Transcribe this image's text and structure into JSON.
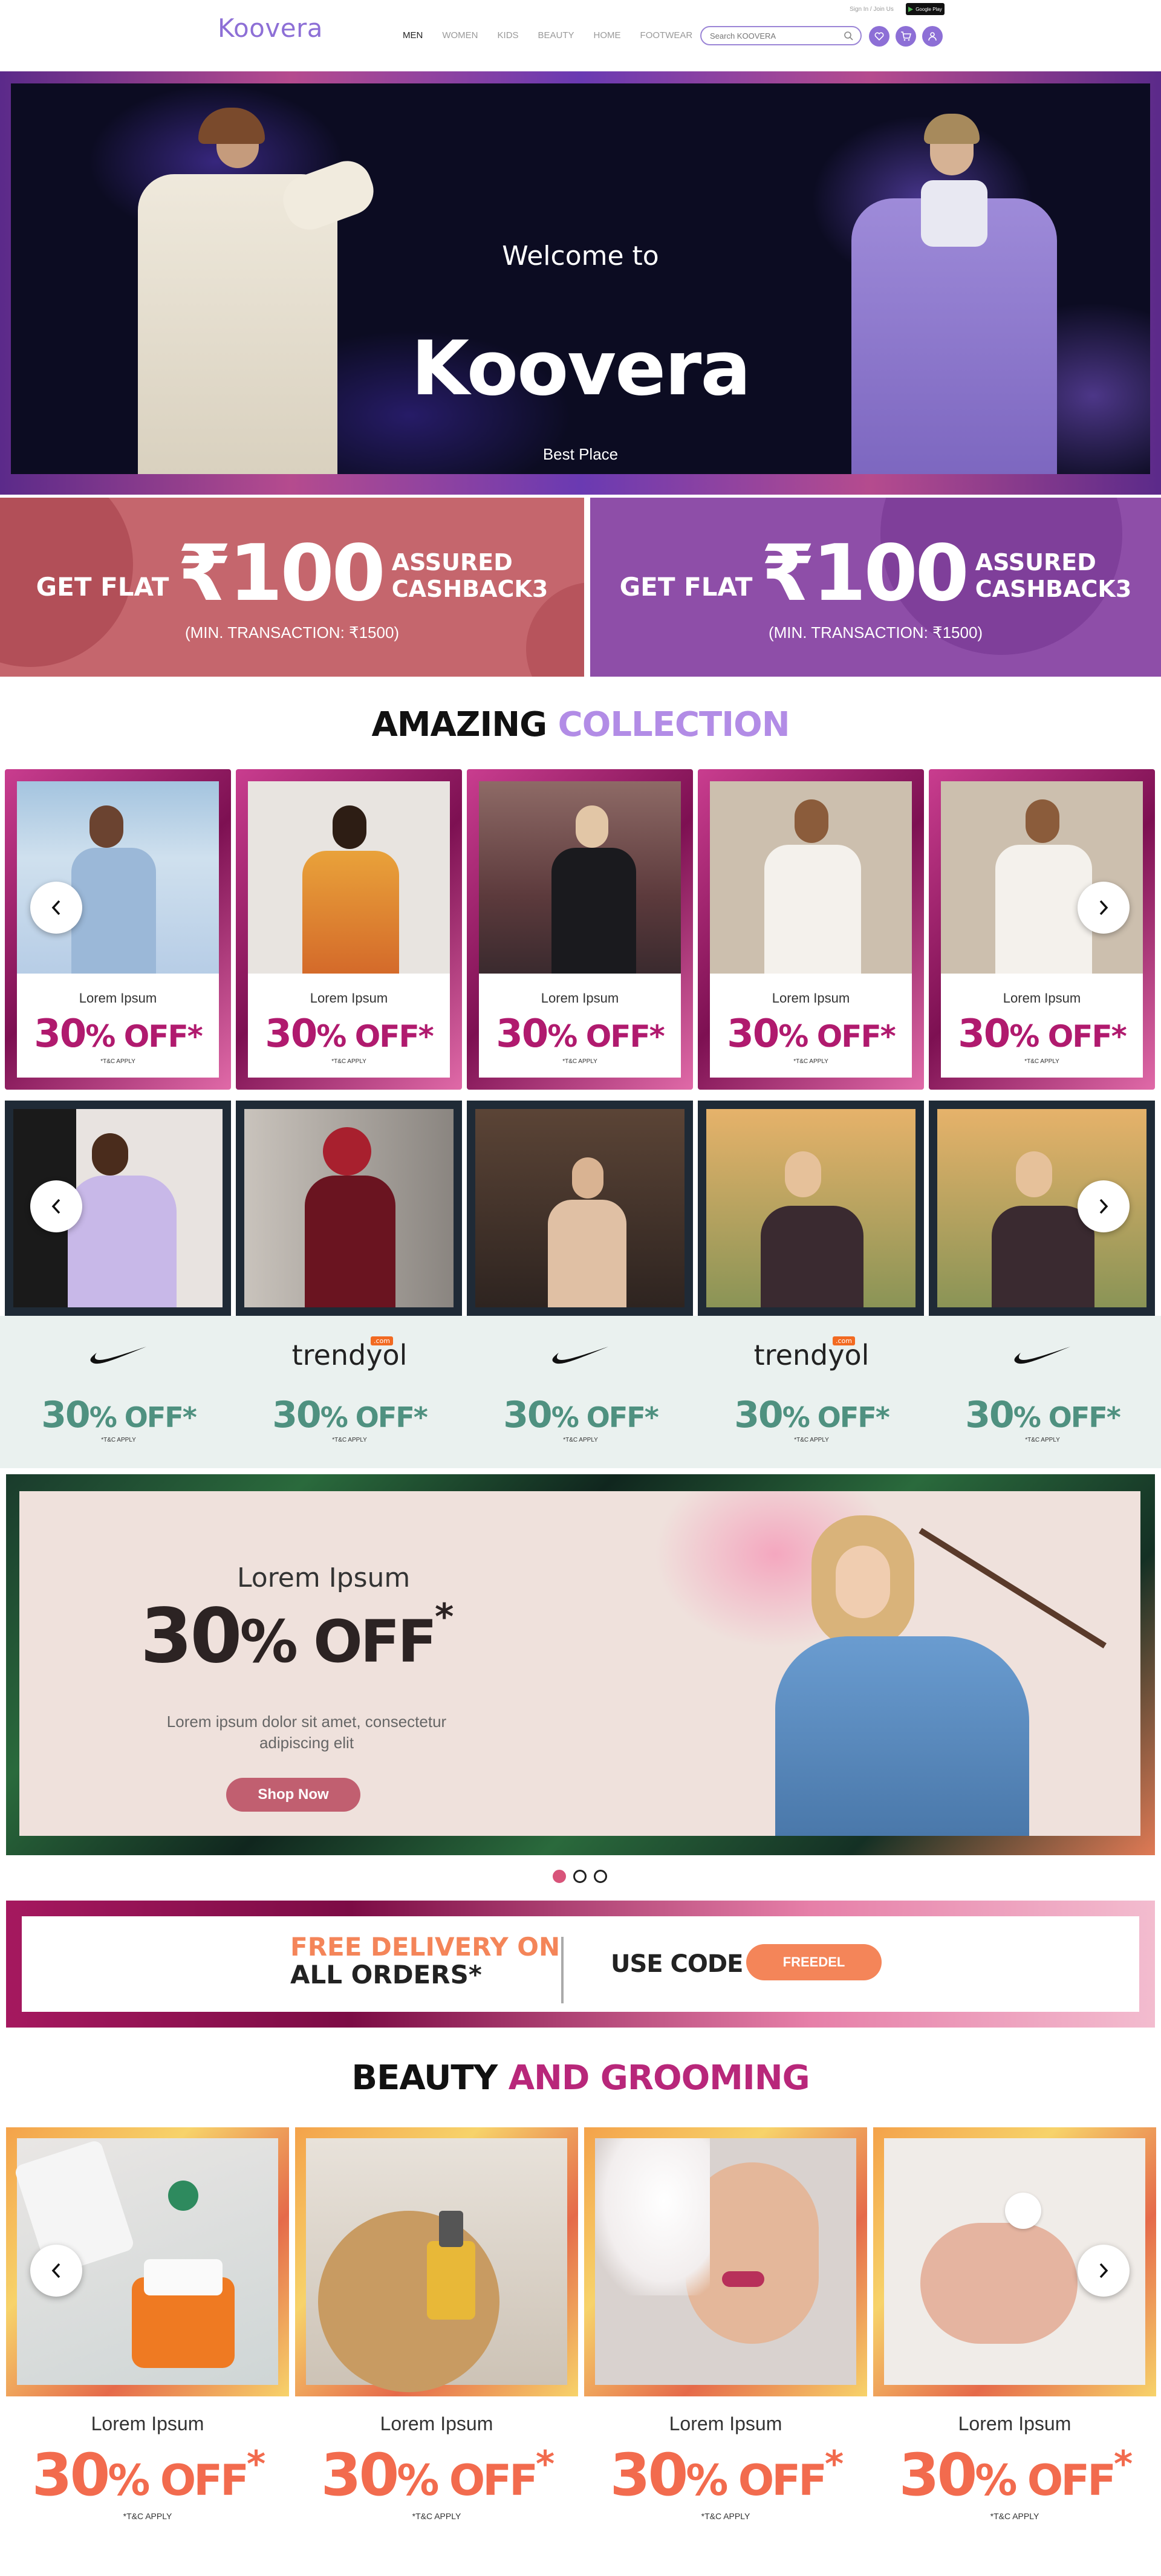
{
  "header": {
    "logo": "Koovera",
    "nav": [
      "MEN",
      "WOMEN",
      "KIDS",
      "BEAUTY",
      "HOME",
      "FOOTWEAR"
    ],
    "search_placeholder": "Search KOOVERA",
    "signin": "Sign In / Join Us",
    "store_badge": "Google Play"
  },
  "hero": {
    "welcome": "Welcome to",
    "title": "Koovera",
    "subtitle": "Best Place"
  },
  "cashback": [
    {
      "flat": "GET FLAT",
      "amount": "₹100",
      "assured": "ASSURED",
      "cashback": "CASHBACK3",
      "min": "(MIN. TRANSACTION: ₹1500)",
      "color": "#c5666d"
    },
    {
      "flat": "GET FLAT",
      "amount": "₹100",
      "assured": "ASSURED",
      "cashback": "CASHBACK3",
      "min": "(MIN. TRANSACTION: ₹1500)",
      "color": "#8e4ea8"
    }
  ],
  "collection": {
    "heading_a": "AMAZING",
    "heading_b": "COLLECTION",
    "cards": [
      {
        "name": "Lorem Ipsum",
        "off": "30",
        "off_suffix": "% OFF",
        "star": "*",
        "tc": "*T&C APPLY"
      },
      {
        "name": "Lorem Ipsum",
        "off": "30",
        "off_suffix": "% OFF",
        "star": "*",
        "tc": "*T&C APPLY"
      },
      {
        "name": "Lorem Ipsum",
        "off": "30",
        "off_suffix": "% OFF",
        "star": "*",
        "tc": "*T&C APPLY"
      },
      {
        "name": "Lorem Ipsum",
        "off": "30",
        "off_suffix": "% OFF",
        "star": "*",
        "tc": "*T&C APPLY"
      },
      {
        "name": "Lorem Ipsum",
        "off": "30",
        "off_suffix": "% OFF",
        "star": "*",
        "tc": "*T&C APPLY"
      }
    ]
  },
  "brands": [
    {
      "logo": "nike-swoosh",
      "off": "30",
      "off_suffix": "% OFF",
      "star": "*",
      "tc": "*T&C APPLY"
    },
    {
      "logo": "trendyol",
      "badge": ".com",
      "off": "30",
      "off_suffix": "% OFF",
      "star": "*",
      "tc": "*T&C APPLY"
    },
    {
      "logo": "nike-swoosh",
      "off": "30",
      "off_suffix": "% OFF",
      "star": "*",
      "tc": "*T&C APPLY"
    },
    {
      "logo": "trendyol",
      "badge": ".com",
      "off": "30",
      "off_suffix": "% OFF",
      "star": "*",
      "tc": "*T&C APPLY"
    },
    {
      "logo": "nike-swoosh",
      "off": "30",
      "off_suffix": "% OFF",
      "star": "*",
      "tc": "*T&C APPLY"
    }
  ],
  "promo": {
    "small": "Lorem Ipsum",
    "off": "30",
    "off_suffix": "% OFF",
    "star": "*",
    "desc": "Lorem ipsum dolor sit amet, consectetur adipiscing elit",
    "button": "Shop Now"
  },
  "delivery": {
    "line1": "FREE DELIVERY ON",
    "line2": "ALL ORDERS*",
    "use_code": "USE CODE",
    "code": "FREEDEL"
  },
  "beauty": {
    "heading_a": "BEAUTY",
    "heading_b": "AND GROOMING",
    "cards": [
      {
        "name": "Lorem Ipsum",
        "off": "30",
        "off_suffix": "% OFF",
        "star": "*",
        "tc": "*T&C APPLY"
      },
      {
        "name": "Lorem Ipsum",
        "off": "30",
        "off_suffix": "% OFF",
        "star": "*",
        "tc": "*T&C APPLY"
      },
      {
        "name": "Lorem Ipsum",
        "off": "30",
        "off_suffix": "% OFF",
        "star": "*",
        "tc": "*T&C APPLY"
      },
      {
        "name": "Lorem Ipsum",
        "off": "30",
        "off_suffix": "% OFF",
        "star": "*",
        "tc": "*T&C APPLY"
      }
    ]
  },
  "colors": {
    "brand_purple": "#8d6fd6",
    "collection_magenta": "#b01a6e",
    "brand_teal": "#4f9180",
    "beauty_orange": "#f26b4e",
    "beauty_magenta": "#b8277a"
  }
}
